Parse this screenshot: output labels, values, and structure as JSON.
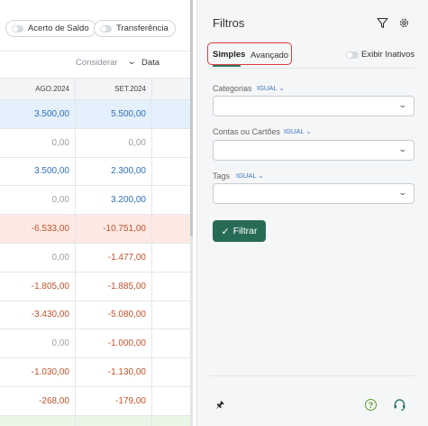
{
  "toolbar": {
    "acerto_label": "Acerto de Saldo",
    "transferencia_label": "Transferência",
    "considerar_label": "Considerar",
    "considerar_value": "Data"
  },
  "table": {
    "headers": [
      "AGO.2024",
      "SET.2024"
    ],
    "rows": [
      {
        "values": [
          "3.500,00",
          "5.500,00"
        ],
        "style": "blue-row"
      },
      {
        "values": [
          "0,00",
          "0,00"
        ],
        "style": "gray"
      },
      {
        "values": [
          "3.500,00",
          "2.300,00"
        ],
        "style": "blue"
      },
      {
        "values": [
          "0,00",
          "3.200,00"
        ],
        "style": "gray-blue"
      },
      {
        "values": [
          "-6.533,00",
          "-10.751,00"
        ],
        "style": "red-row"
      },
      {
        "values": [
          "0,00",
          "-1.477,00"
        ],
        "style": "gray-red"
      },
      {
        "values": [
          "-1.805,00",
          "-1.885,00"
        ],
        "style": "red"
      },
      {
        "values": [
          "-3.430,00",
          "-5.080,00"
        ],
        "style": "red"
      },
      {
        "values": [
          "0,00",
          "-1.000,00"
        ],
        "style": "gray-red"
      },
      {
        "values": [
          "-1.030,00",
          "-1.130,00"
        ],
        "style": "red"
      },
      {
        "values": [
          "-268,00",
          "-179,00"
        ],
        "style": "red"
      },
      {
        "values": [
          "",
          ""
        ],
        "style": "green-row"
      }
    ]
  },
  "filters": {
    "title": "Filtros",
    "tabs": {
      "simples": "Simples",
      "avancado": "Avançado"
    },
    "exibir_inativos": "Exibir Inativos",
    "fields": [
      {
        "label": "Categorias",
        "operator": "IGUAL"
      },
      {
        "label": "Contas ou Cartões",
        "operator": "IGUAL"
      },
      {
        "label": "Tags",
        "operator": "IGUAL"
      }
    ],
    "filtrar_label": "Filtrar"
  },
  "colors": {
    "accent": "#276b57",
    "highlight": "#d9413b",
    "positive": "#2f6fba",
    "negative": "#c0532d"
  },
  "icons": [
    "funnel-icon",
    "gear-icon",
    "pin-icon",
    "help-icon",
    "headset-icon",
    "chevron-down-icon",
    "check-icon"
  ]
}
